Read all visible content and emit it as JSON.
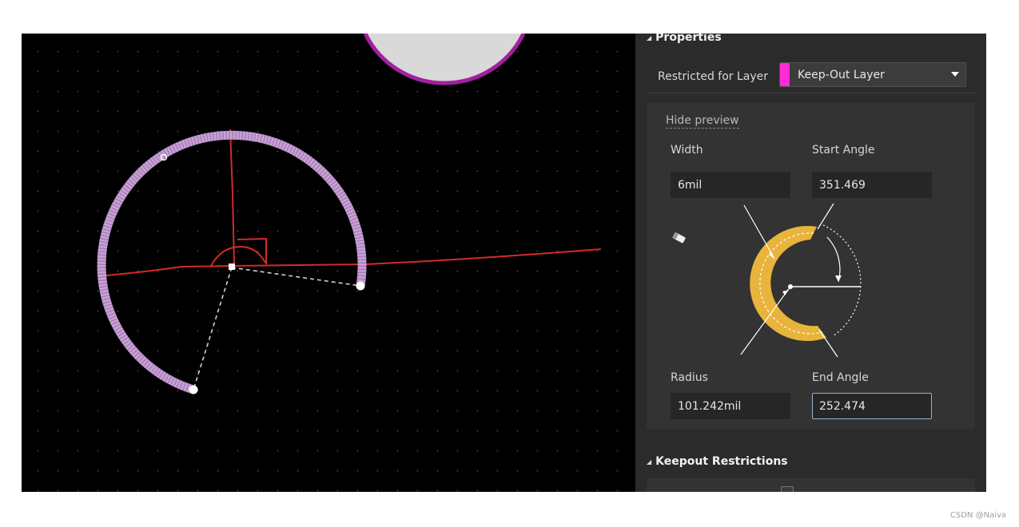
{
  "properties_section": {
    "title": "Properties",
    "restricted_label": "Restricted for Layer",
    "layer_value": "Keep-Out Layer",
    "layer_color": "#ff2bd6",
    "hide_preview": "Hide preview",
    "width_label": "Width",
    "width_value": "6mil",
    "start_angle_label": "Start Angle",
    "start_angle_value": "351.469",
    "radius_label": "Radius",
    "radius_value": "101.242mil",
    "end_angle_label": "End Angle",
    "end_angle_value": "252.474"
  },
  "keepout_section": {
    "title": "Keepout Restrictions"
  },
  "icons": {
    "section_toggle": "collapse-triangle-icon",
    "dropdown": "chevron-down-icon",
    "eraser": "eraser-icon"
  },
  "colors": {
    "canvas_bg": "#000000",
    "arc_color": "#c9a2d6",
    "annotation_color": "#d42a2a",
    "panel_bg": "#2b2b2b",
    "preview_arc": "#e8b43c"
  },
  "watermark": "CSDN @Naiva"
}
